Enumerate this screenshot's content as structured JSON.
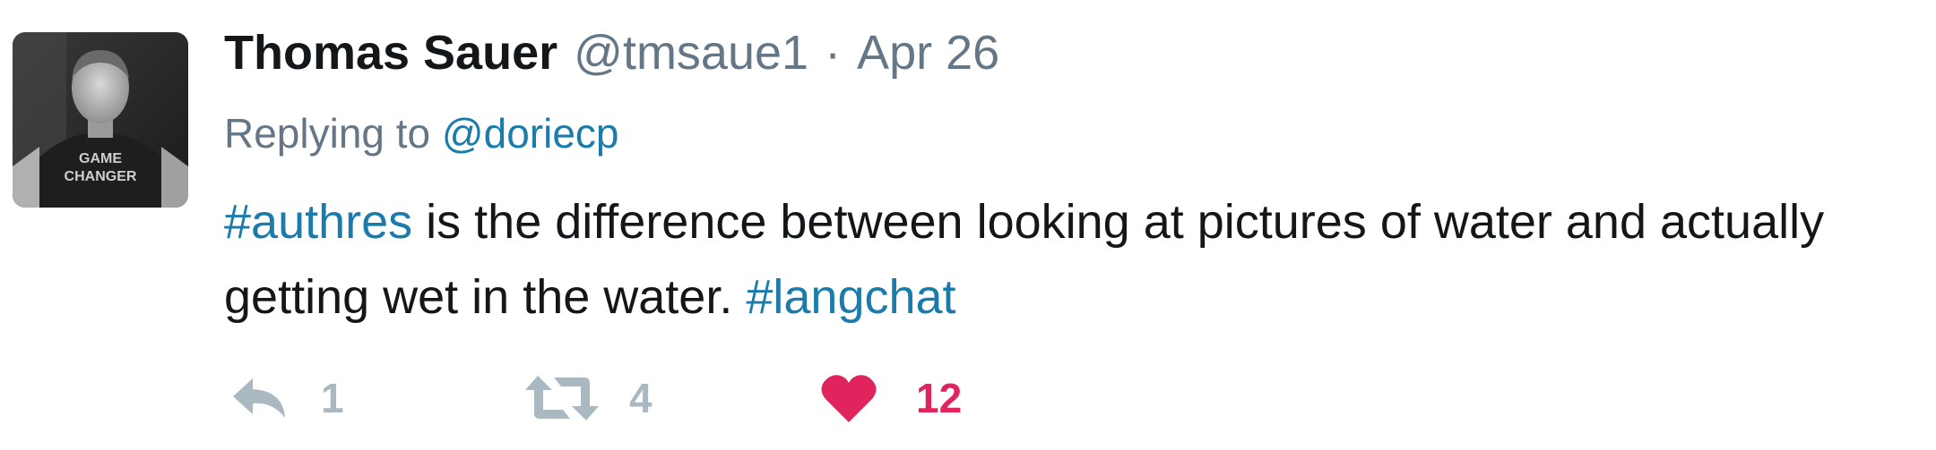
{
  "author": {
    "full_name": "Thomas Sauer",
    "screen_name": "@tmsaue1",
    "separator": "·",
    "timestamp": "Apr 26",
    "avatar_shirt_text": "GAME CHANGER"
  },
  "reply_context": {
    "prefix": "Replying to",
    "mention": "@doriecp"
  },
  "tweet": {
    "hashtag_1": "#authres",
    "text_line_1": " is the difference between looking at pictures of water and actually",
    "text_line_2": "getting wet in the water. ",
    "hashtag_2": "#langchat"
  },
  "actions": {
    "reply": {
      "icon": "reply-icon",
      "count": "1"
    },
    "retweet": {
      "icon": "retweet-icon",
      "count": "4"
    },
    "like": {
      "icon": "heart-icon",
      "count": "12",
      "active": true
    }
  },
  "colors": {
    "link": "#1b7bab",
    "muted": "#657786",
    "text": "#14171a",
    "icon_gray": "#aab8c2",
    "like_red": "#e0245e"
  }
}
